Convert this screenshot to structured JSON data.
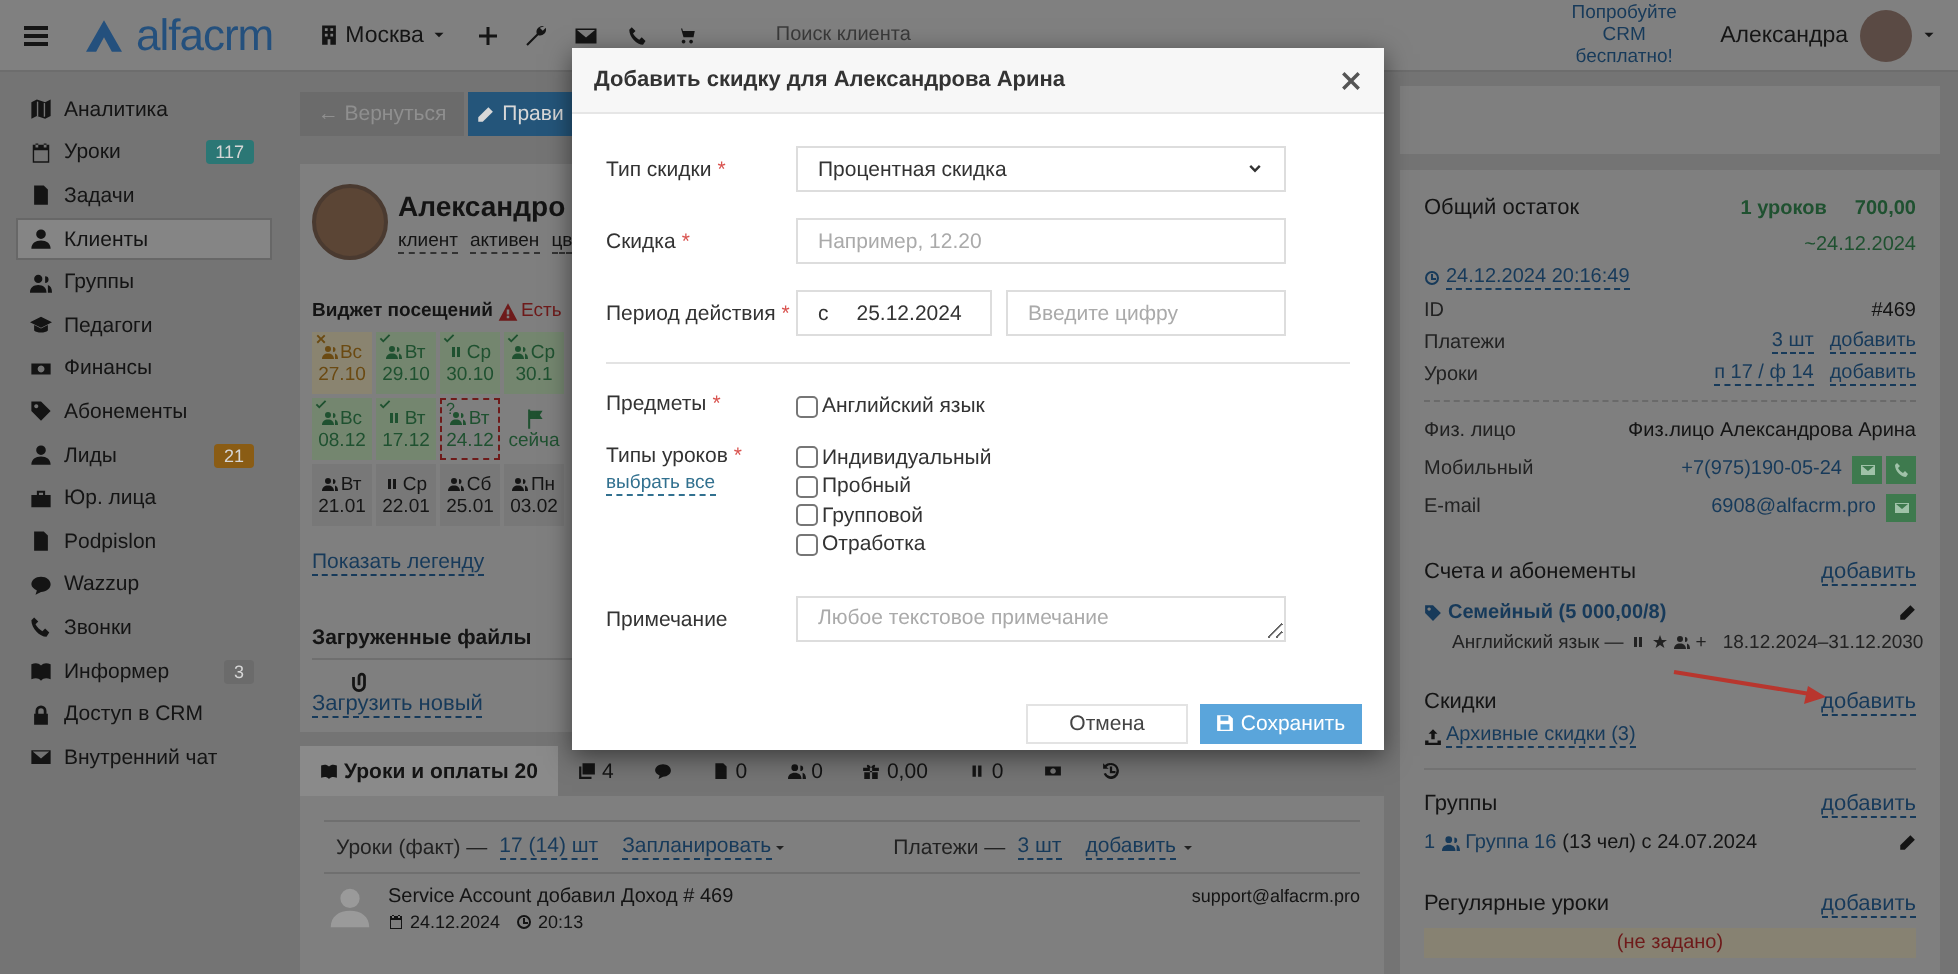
{
  "topbar": {
    "logo": "alfacrm",
    "branch": "Москва",
    "search": {
      "placeholder": "Поиск клиента"
    },
    "promo": "Попробуйте CRM бесплатно!",
    "user": "Александра"
  },
  "sidebar": {
    "items": [
      {
        "label": "Аналитика",
        "selected": false
      },
      {
        "label": "Уроки",
        "selected": false,
        "badge": "117",
        "color": "#2b7775"
      },
      {
        "label": "Задачи",
        "selected": false
      },
      {
        "label": "Клиенты",
        "selected": true
      },
      {
        "label": "Группы",
        "selected": false
      },
      {
        "label": "Педагоги",
        "selected": false
      },
      {
        "label": "Финансы",
        "selected": false
      },
      {
        "label": "Абонементы",
        "selected": false
      },
      {
        "label": "Лиды",
        "selected": false,
        "badge": "21",
        "color": "#8a5c14"
      },
      {
        "label": "Юр. лица",
        "selected": false
      },
      {
        "label": "Podpislon",
        "selected": false
      },
      {
        "label": "Wazzup",
        "selected": false
      },
      {
        "label": "Звонки",
        "selected": false
      },
      {
        "label": "Информер",
        "selected": false,
        "badge": "3",
        "color": "#6b6b6b"
      },
      {
        "label": "Доступ в CRM",
        "selected": false
      },
      {
        "label": "Внутренний чат",
        "selected": false
      }
    ]
  },
  "toolbar": {
    "buttons": [
      {
        "label": "← Вернуться",
        "kind": "back"
      },
      {
        "label": "Прави",
        "kind": "edit"
      }
    ]
  },
  "client": {
    "name": "Александро",
    "tags": [
      "клиент",
      "активен",
      "цв"
    ]
  },
  "attendance": {
    "title": "Виджет посещений",
    "warning": "Есть",
    "cells": [
      {
        "day": "Вс",
        "date": "27.10",
        "kind": "missed",
        "group": false
      },
      {
        "day": "Вт",
        "date": "29.10",
        "kind": "attended",
        "group": false
      },
      {
        "day": "Ср",
        "date": "30.10",
        "kind": "attended",
        "group": true
      },
      {
        "day": "Ср",
        "date": "30.1",
        "kind": "attended",
        "group": false
      },
      {
        "day": "Вс",
        "date": "08.12",
        "kind": "attended",
        "group": false
      },
      {
        "day": "Вт",
        "date": "17.12",
        "kind": "attended",
        "group": true
      },
      {
        "day": "Вт",
        "date": "24.12",
        "kind": "pending",
        "group": false,
        "mark": "?"
      },
      {
        "date": "сейча",
        "kind": "now"
      },
      {
        "day": "Вт",
        "date": "21.01",
        "kind": "planned",
        "group": false
      },
      {
        "day": "Ср",
        "date": "22.01",
        "kind": "planned",
        "group": true
      },
      {
        "day": "Сб",
        "date": "25.01",
        "kind": "planned",
        "group": false
      },
      {
        "day": "Пн",
        "date": "03.02",
        "kind": "planned",
        "group": false
      }
    ],
    "legend_link": "Показать легенду"
  },
  "files": {
    "title": "Загруженные файлы",
    "upload": "Загрузить новый"
  },
  "tabs": [
    {
      "label": "Уроки и оплаты 20",
      "selected": true
    },
    {
      "label": "4",
      "selected": false
    },
    {
      "selected": false
    },
    {
      "label": "0",
      "selected": false
    },
    {
      "label": "0",
      "selected": false
    },
    {
      "label": "0,00",
      "selected": false
    },
    {
      "label": "0",
      "selected": false
    },
    {
      "selected": false
    },
    {
      "selected": false
    }
  ],
  "lessons_bar": {
    "lessons_label": "Уроки (факт) —",
    "lessons_count": "17 (14) шт",
    "plan": "Запланировать",
    "payments_label": "Платежи —",
    "payments_count": "3 шт",
    "add": "добавить"
  },
  "feed": [
    {
      "text": "Service Account добавил Доход # 469",
      "date": "24.12.2024",
      "time": "20:13",
      "author": "support@alfacrm.pro"
    }
  ],
  "right_panel": {
    "balance": {
      "title": "Общий остаток",
      "lessons": "1 уроков",
      "amount": "700,00",
      "until": "~24.12.2024",
      "timestamp": "24.12.2024 20:16:49"
    },
    "fields": [
      {
        "label": "ID",
        "value": "#469",
        "kind": "plain"
      },
      {
        "label": "Платежи",
        "value": "3 шт",
        "action": "добавить",
        "kind": "link"
      },
      {
        "label": "Уроки",
        "value": "п 17 / ф 14",
        "action": "добавить",
        "kind": "link"
      },
      {
        "label": "Физ. лицо",
        "value": "Физ.лицо Александрова Арина",
        "kind": "plain"
      },
      {
        "label": "Мобильный",
        "value": "+7(975)190-05-24",
        "kind": "phone"
      },
      {
        "label": "E-mail",
        "value": "6908@alfacrm.pro",
        "kind": "email"
      }
    ],
    "subscriptions": {
      "title": "Счета и абонементы",
      "action": "добавить",
      "items": [
        {
          "name": "Семейный (5 000,00/8)",
          "subject": "Английский язык —",
          "extra": "+",
          "period": "18.12.2024–31.12.2030"
        }
      ]
    },
    "discounts": {
      "title": "Скидки",
      "action": "добавить",
      "archive": "Архивные скидки (3)"
    },
    "groups": {
      "title": "Группы",
      "action": "добавить",
      "items": [
        {
          "number": "1",
          "name": "Группа 16",
          "details": "(13 чел) с 24.07.2024"
        }
      ]
    },
    "regular_lessons": {
      "title": "Регулярные уроки",
      "action": "добавить",
      "empty": "(не задано)"
    }
  },
  "modal": {
    "title": "Добавить скидку для Александрова Арина",
    "fields": [
      {
        "kind": "select",
        "label": "Тип скидки",
        "required_mark": "*",
        "value": "Процентная скидка"
      },
      {
        "kind": "input",
        "label": "Скидка",
        "required_mark": "*",
        "placeholder": "Например, 12.20"
      },
      {
        "kind": "period",
        "label": "Период действия",
        "required_mark": "*",
        "prefix": "с",
        "value": "25.12.2024",
        "placeholder": "Введите цифру"
      },
      {
        "kind": "checkboxes",
        "label": "Предметы",
        "required_mark": "*",
        "options": [
          {
            "label": "Английский язык",
            "checked": false
          }
        ]
      },
      {
        "kind": "checkboxes",
        "label": "Типы уроков",
        "required_mark": "*",
        "link": "выбрать все",
        "options": [
          {
            "label": "Индивидуальный",
            "checked": false
          },
          {
            "label": "Пробный",
            "checked": false
          },
          {
            "label": "Групповой",
            "checked": false
          },
          {
            "label": "Отработка",
            "checked": false
          }
        ]
      },
      {
        "kind": "textarea",
        "label": "Примечание",
        "placeholder": "Любое текстовое примечание"
      }
    ],
    "buttons": [
      {
        "label": "Отмена",
        "kind": "secondary"
      },
      {
        "label": "Сохранить",
        "kind": "primary"
      }
    ]
  }
}
